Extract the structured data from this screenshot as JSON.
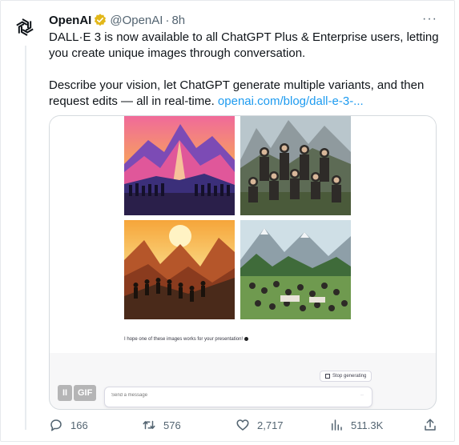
{
  "author": {
    "name": "OpenAI",
    "handle": "@OpenAI",
    "separator": "·",
    "time": "8h"
  },
  "more_label": "···",
  "tweet": {
    "line1": "DALL·E 3 is now available to all ChatGPT Plus & Enterprise users, letting you create unique images through conversation.",
    "line2": "Describe your vision, let ChatGPT generate multiple variants, and then request edits — all in real-time.",
    "link_text": "openai.com/blog/dall-e-3-..."
  },
  "media": {
    "caption": "I hope one of these images works for your presentation!",
    "stop_label": "Stop generating",
    "composer_placeholder": "Send a message",
    "send_glyph": "··",
    "pause_glyph": "II",
    "gif_label": "GIF"
  },
  "stats": {
    "replies": "166",
    "reposts": "576",
    "likes": "2,717",
    "views": "511.3K"
  },
  "colors": {
    "link": "#1d9bf0",
    "verified": "#e2b719",
    "muted": "#536471"
  }
}
